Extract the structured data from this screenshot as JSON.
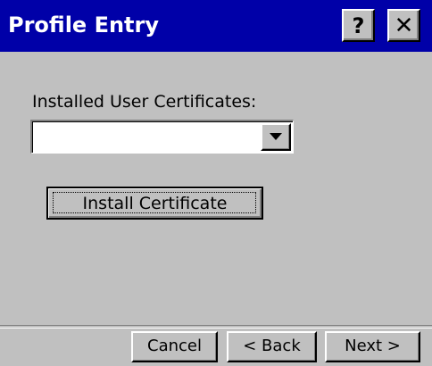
{
  "window": {
    "title": "Profile Entry",
    "help_label": "?",
    "close_label": "✕"
  },
  "form": {
    "certificates_label": "Installed User Certificates:",
    "certificates_value": "",
    "install_button_label": "Install Certificate"
  },
  "footer": {
    "cancel_label": "Cancel",
    "back_label": "< Back",
    "next_label": "Next >"
  }
}
